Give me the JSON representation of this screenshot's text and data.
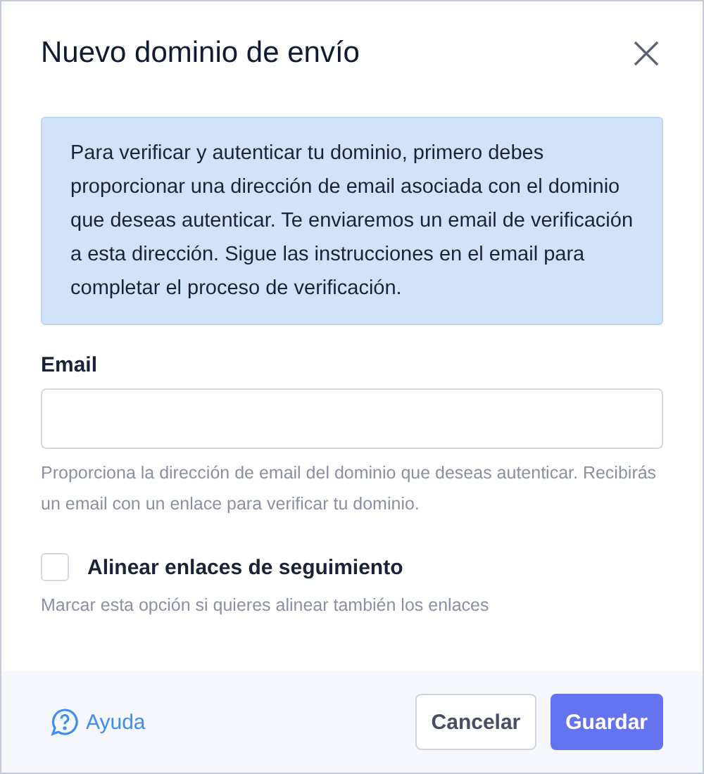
{
  "dialog": {
    "title": "Nuevo dominio de envío"
  },
  "info": "Para verificar y autenticar tu dominio, primero debes proporcionar una dirección de email asociada con el dominio que deseas autenticar. Te enviaremos un email de verificación a esta dirección. Sigue las instrucciones en el email para completar el proceso de verificación.",
  "email": {
    "label": "Email",
    "help": "Proporciona la dirección de email del dominio que deseas autenticar. Recibirás un email con un enlace para verificar tu dominio."
  },
  "option": {
    "label": "Alinear enlaces de seguimiento",
    "checked": false,
    "hint": "Marcar esta opción si quieres alinear también los enlaces"
  },
  "footer": {
    "help_link": "Ayuda",
    "buttons": [
      {
        "label": "Cancelar",
        "kind": "secondary"
      },
      {
        "label": "Guardar",
        "kind": "primary"
      }
    ]
  }
}
